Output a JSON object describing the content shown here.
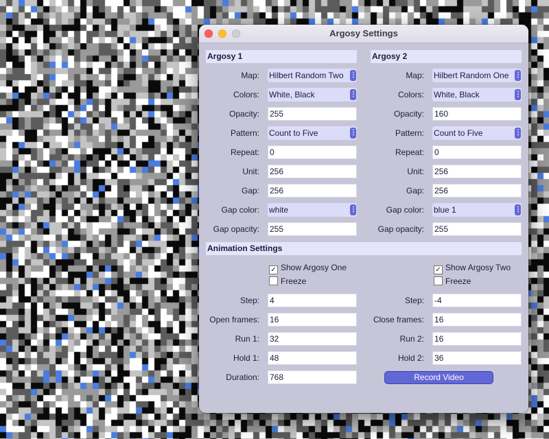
{
  "window": {
    "title": "Argosy Settings"
  },
  "argosy1": {
    "heading": "Argosy 1",
    "map_label": "Map:",
    "map": "Hilbert Random Two",
    "colors_label": "Colors:",
    "colors": "White, Black",
    "opacity_label": "Opacity:",
    "opacity": "255",
    "pattern_label": "Pattern:",
    "pattern": "Count to Five",
    "repeat_label": "Repeat:",
    "repeat": "0",
    "unit_label": "Unit:",
    "unit": "256",
    "gap_label": "Gap:",
    "gap": "256",
    "gap_color_label": "Gap color:",
    "gap_color": "white",
    "gap_opacity_label": "Gap opacity:",
    "gap_opacity": "255"
  },
  "argosy2": {
    "heading": "Argosy 2",
    "map_label": "Map:",
    "map": "Hilbert Random One",
    "colors_label": "Colors:",
    "colors": "White, Black",
    "opacity_label": "Opacity:",
    "opacity": "160",
    "pattern_label": "Pattern:",
    "pattern": "Count to Five",
    "repeat_label": "Repeat:",
    "repeat": "0",
    "unit_label": "Unit:",
    "unit": "256",
    "gap_label": "Gap:",
    "gap": "256",
    "gap_color_label": "Gap color:",
    "gap_color": "blue 1",
    "gap_opacity_label": "Gap opacity:",
    "gap_opacity": "255"
  },
  "animation": {
    "heading": "Animation Settings",
    "show_one_label": "Show Argosy One",
    "show_one_checked": true,
    "freeze1_label": "Freeze",
    "freeze1_checked": false,
    "show_two_label": "Show Argosy Two",
    "show_two_checked": true,
    "freeze2_label": "Freeze",
    "freeze2_checked": false,
    "step1_label": "Step:",
    "step1": "4",
    "open_frames_label": "Open frames:",
    "open_frames": "16",
    "run1_label": "Run 1:",
    "run1": "32",
    "hold1_label": "Hold 1:",
    "hold1": "48",
    "duration_label": "Duration:",
    "duration": "768",
    "step2_label": "Step:",
    "step2": "-4",
    "close_frames_label": "Close frames:",
    "close_frames": "16",
    "run2_label": "Run 2:",
    "run2": "16",
    "hold2_label": "Hold 2:",
    "hold2": "36",
    "record_label": "Record Video"
  },
  "icons": {
    "chevron": "up-down-chevron-icon",
    "check": "checkmark-icon"
  },
  "colors": {
    "accent": "#6267d6",
    "section_bg": "#e4e4fc",
    "window_bg": "#c7c6d8",
    "pattern_palette": [
      "#0a0a0a",
      "#5c5c5c",
      "#9a9a9a",
      "#c4c4c4",
      "#ffffff",
      "#4a7de0"
    ]
  }
}
